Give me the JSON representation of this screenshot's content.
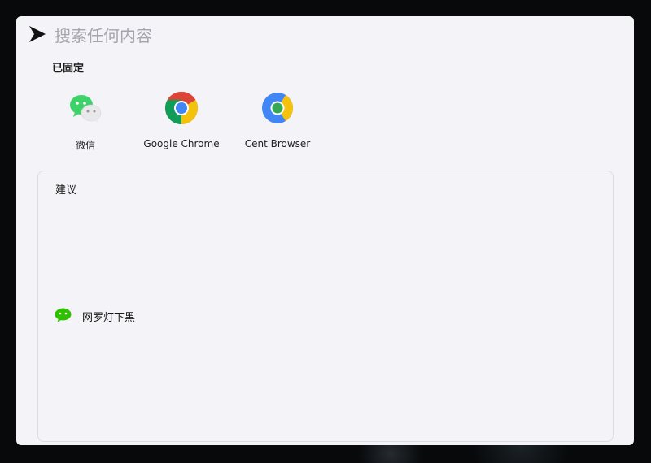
{
  "search": {
    "placeholder": "搜索任何内容",
    "value": ""
  },
  "pinned": {
    "title": "已固定",
    "apps": [
      {
        "label": "微信",
        "icon": "wechat-icon"
      },
      {
        "label": "Google Chrome",
        "icon": "chrome-icon"
      },
      {
        "label": "Cent Browser",
        "icon": "cent-browser-icon"
      }
    ]
  },
  "suggestions": {
    "title": "建议",
    "items": [
      {
        "label": "网罗灯下黑",
        "icon": "wechat-icon"
      }
    ]
  },
  "colors": {
    "wechat_green": "#2dc100",
    "panel_bg": "#f3f3f8",
    "chrome_red": "#db4437",
    "chrome_yellow": "#f4c20d",
    "chrome_green": "#0f9d58",
    "chrome_blue": "#4285f4"
  }
}
